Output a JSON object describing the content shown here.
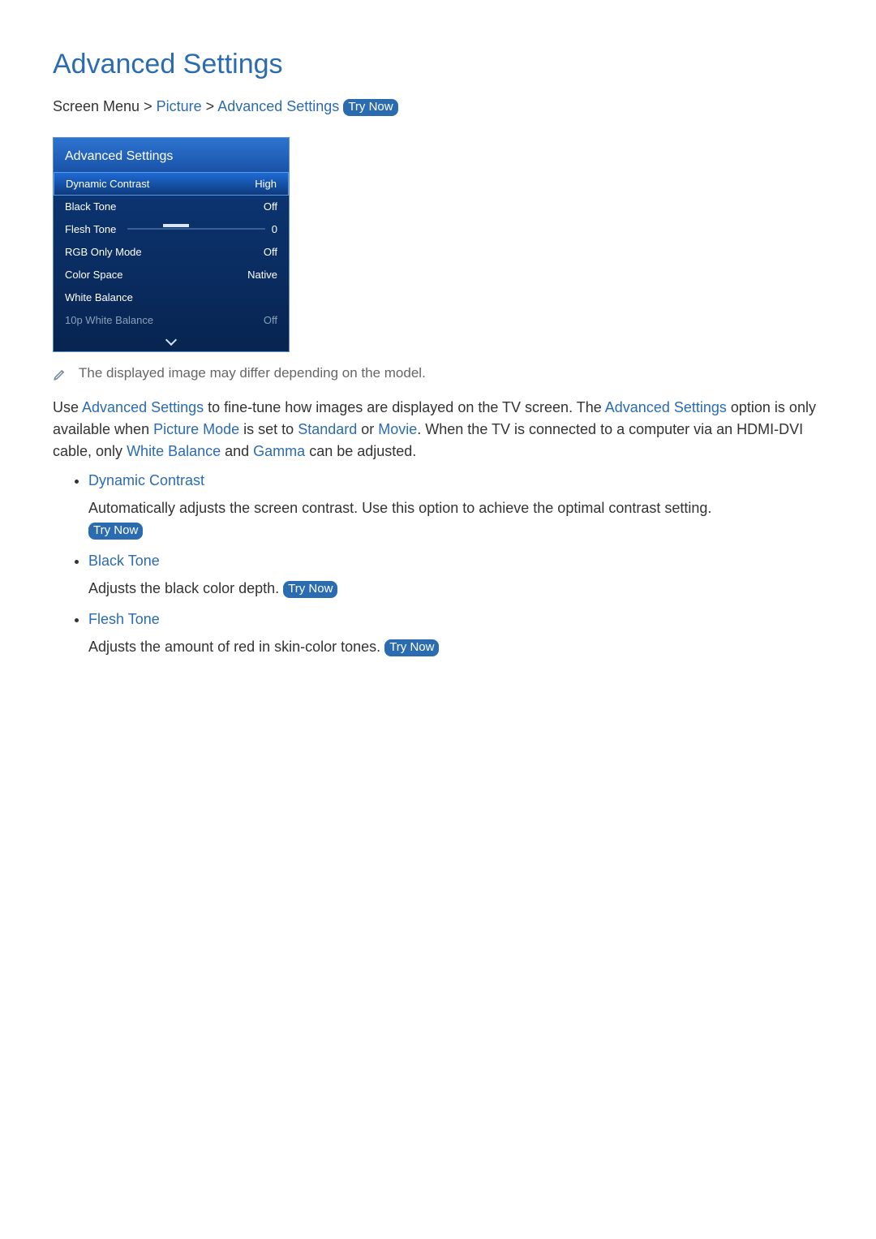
{
  "page": {
    "title": "Advanced Settings"
  },
  "breadcrumb": {
    "root": "Screen Menu",
    "sep": ">",
    "p1": "Picture",
    "p2": "Advanced Settings",
    "try_now": "Try Now"
  },
  "menu": {
    "header": "Advanced Settings",
    "rows": {
      "dynamic_contrast": {
        "label": "Dynamic Contrast",
        "value": "High"
      },
      "black_tone": {
        "label": "Black Tone",
        "value": "Off"
      },
      "flesh_tone": {
        "label": "Flesh Tone",
        "value": "0"
      },
      "rgb_only": {
        "label": "RGB Only Mode",
        "value": "Off"
      },
      "color_space": {
        "label": "Color Space",
        "value": "Native"
      },
      "white_balance": {
        "label": "White Balance",
        "value": ""
      },
      "tenp_white": {
        "label": "10p White Balance",
        "value": "Off"
      }
    }
  },
  "note": "The displayed image may differ depending on the model.",
  "para": {
    "t1": "Use ",
    "kw1": "Advanced Settings",
    "t2": " to fine-tune how images are displayed on the TV screen. The ",
    "kw2": "Advanced Settings",
    "t3": " option is only available when ",
    "kw3": "Picture Mode",
    "t4": " is set to ",
    "kw4": "Standard",
    "t5": " or ",
    "kw5": "Movie",
    "t6": ". When the TV is connected to a computer via an HDMI-DVI cable, only ",
    "kw6": "White Balance",
    "t7": " and ",
    "kw7": "Gamma",
    "t8": " can be adjusted."
  },
  "features": {
    "dynamic_contrast": {
      "title": "Dynamic Contrast",
      "desc": "Automatically adjusts the screen contrast. Use this option to achieve the optimal contrast setting. ",
      "try_now": "Try Now"
    },
    "black_tone": {
      "title": "Black Tone",
      "desc": "Adjusts the black color depth. ",
      "try_now": "Try Now"
    },
    "flesh_tone": {
      "title": "Flesh Tone",
      "desc": "Adjusts the amount of red in skin-color tones. ",
      "try_now": "Try Now"
    }
  }
}
